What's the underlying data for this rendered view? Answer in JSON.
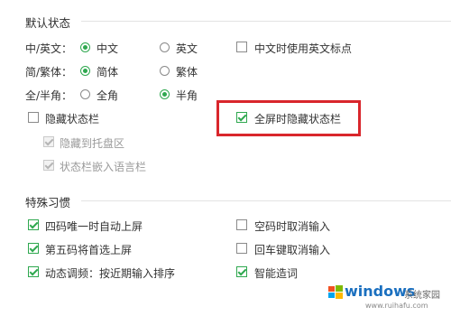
{
  "default_state": {
    "title": "默认状态",
    "cn_en_label": "中/英文：",
    "cn_option": "中文",
    "en_option": "英文",
    "cn_en_selected": "中文",
    "en_punct_label": "中文时使用英文标点",
    "en_punct_checked": false,
    "simp_trad_label": "简/繁体：",
    "simp_option": "简体",
    "trad_option": "繁体",
    "simp_trad_selected": "简体",
    "full_half_label": "全/半角：",
    "full_option": "全角",
    "half_option": "半角",
    "full_half_selected": "半角",
    "hide_statusbar_label": "隐藏状态栏",
    "hide_statusbar_checked": false,
    "fullscreen_hide_label": "全屏时隐藏状态栏",
    "fullscreen_hide_checked": true,
    "hide_tray_label": "隐藏到托盘区",
    "hide_tray_checked": true,
    "embed_langbar_label": "状态栏嵌入语言栏",
    "embed_langbar_checked": true
  },
  "special_habits": {
    "title": "特殊习惯",
    "items": [
      {
        "label": "四码唯一时自动上屏",
        "checked": true
      },
      {
        "label": "空码时取消输入",
        "checked": false
      },
      {
        "label": "第五码将首选上屏",
        "checked": true
      },
      {
        "label": "回车键取消输入",
        "checked": false
      },
      {
        "label": "动态调频：按近期输入排序",
        "checked": true
      },
      {
        "label": "智能造词",
        "checked": true
      }
    ]
  },
  "watermark": {
    "brand": "windows",
    "subtitle": "系统家园",
    "url": "www.ruihafu.com"
  },
  "colors": {
    "accent": "#2fa84f",
    "highlight": "#d9262c"
  }
}
